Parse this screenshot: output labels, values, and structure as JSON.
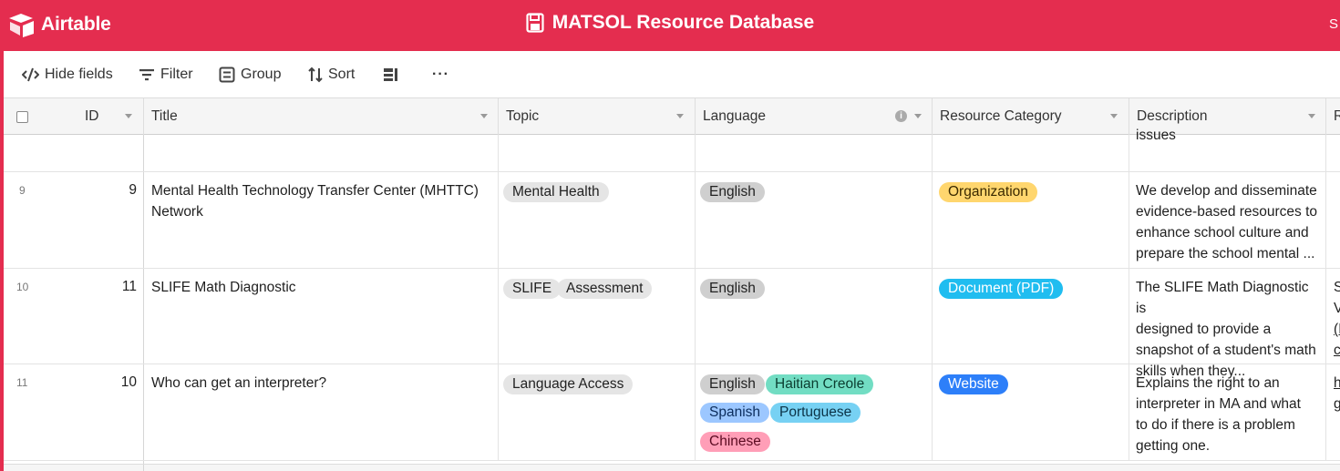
{
  "app": {
    "logo_text": "Airtable",
    "base_title": "MATSOL Resource Database",
    "topright_text": "S"
  },
  "toolbar": {
    "hide_fields": "Hide fields",
    "filter": "Filter",
    "group": "Group",
    "sort": "Sort",
    "more": "···"
  },
  "columns": [
    {
      "label": "ID"
    },
    {
      "label": "Title"
    },
    {
      "label": "Topic"
    },
    {
      "label": "Language"
    },
    {
      "label": "Resource Category"
    },
    {
      "label": "Description"
    },
    {
      "label": "R"
    }
  ],
  "prev_row": {
    "description_tail": "issues"
  },
  "rows": [
    {
      "row_number": "9",
      "id": "9",
      "title_lines": [
        "Mental Health Technology Transfer Center (MHTTC)",
        "Network"
      ],
      "topics": [
        "Mental Health"
      ],
      "languages": [
        "English"
      ],
      "category": "Organization",
      "description_lines": [
        "We develop and disseminate",
        "evidence-based resources to",
        "enhance school culture and",
        "prepare the school mental ..."
      ],
      "next_col_lines": []
    },
    {
      "row_number": "10",
      "id": "11",
      "title_lines": [
        "SLIFE Math Diagnostic"
      ],
      "topics": [
        "SLIFE",
        "Assessment"
      ],
      "languages": [
        "English"
      ],
      "category": "Document (PDF)",
      "description_lines": [
        "The SLIFE Math Diagnostic is",
        "designed to provide a",
        "snapshot of a student's math",
        "skills when they..."
      ],
      "next_col_lines": [
        "S",
        "V",
        "(I",
        "c"
      ]
    },
    {
      "row_number": "11",
      "id": "10",
      "title_lines": [
        "Who can get an interpreter?"
      ],
      "topics": [
        "Language Access"
      ],
      "languages": [
        "English",
        "Haitian Creole",
        "Spanish",
        "Portuguese",
        "Chinese"
      ],
      "category": "Website",
      "description_lines": [
        "Explains the right to an",
        "interpreter in MA and what",
        "to do if there is a problem",
        "getting one."
      ],
      "next_col_lines": [
        "h",
        "g"
      ]
    }
  ],
  "colors": {
    "brand": "#e42d4f",
    "organization": "#ffd66e",
    "document_pdf": "#20bdf0",
    "website": "#2d7ff9",
    "haitian_creole": "#72ddc3",
    "spanish": "#9cc7ff",
    "portuguese": "#77d1f3",
    "chinese": "#ff9eb7"
  }
}
